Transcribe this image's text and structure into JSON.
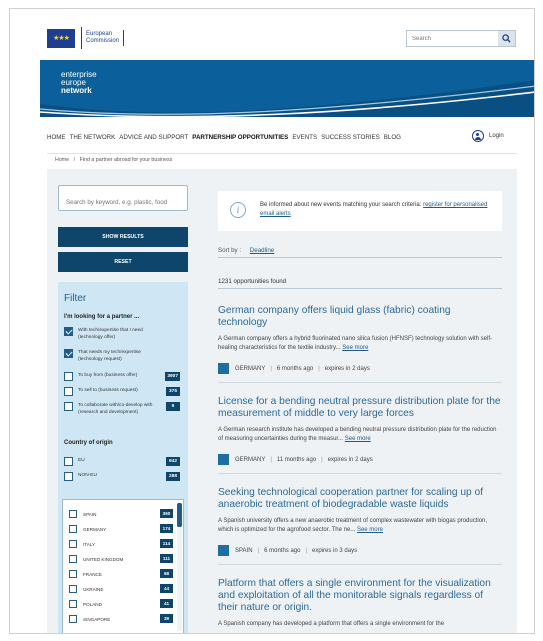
{
  "header": {
    "logo_line1": "European",
    "logo_line2": "Commission",
    "search_placeholder": "Search",
    "brand_line1": "enterprise",
    "brand_line2": "europe",
    "brand_line3": "network",
    "brand_color": "#0b5f9a"
  },
  "nav": {
    "items": [
      "HOME",
      "THE NETWORK",
      "ADVICE AND SUPPORT",
      "PARTNERSHIP OPPORTUNITIES",
      "EVENTS",
      "SUCCESS STORIES",
      "BLOG"
    ],
    "active": "PARTNERSHIP OPPORTUNITIES",
    "login": "Login"
  },
  "breadcrumb": {
    "home": "Home",
    "sep": "/",
    "current": "Find a partner abroad for your business"
  },
  "sidebar": {
    "keyword_placeholder": "Search by keyword, e.g. plastic, food",
    "show_results": "SHOW RESULTS",
    "reset": "RESET",
    "filter_title": "Filter",
    "looking_for_title": "I'm looking for a partner ...",
    "looking_for": [
      {
        "label": "With tech/expertise that I need (technology offer)",
        "checked": true,
        "count": ""
      },
      {
        "label": "That needs my tech/expertise (technology request)",
        "checked": true,
        "count": ""
      },
      {
        "label": "To buy from (business offer)",
        "checked": false,
        "count": "3907"
      },
      {
        "label": "To sell to (business request)",
        "checked": false,
        "count": "375"
      },
      {
        "label": "To collaborate with/co-develop with (research and development)",
        "checked": false,
        "count": "9"
      }
    ],
    "country_title": "Country of origin",
    "regions": [
      {
        "label": "EU",
        "count": "942"
      },
      {
        "label": "NON-EU",
        "count": "288"
      }
    ],
    "countries": [
      {
        "label": "SPAIN",
        "count": "360"
      },
      {
        "label": "GERMANY",
        "count": "174"
      },
      {
        "label": "ITALY",
        "count": "114"
      },
      {
        "label": "UNITED KINGDOM",
        "count": "111"
      },
      {
        "label": "FRANCE",
        "count": "68"
      },
      {
        "label": "UKRAINE",
        "count": "44"
      },
      {
        "label": "POLAND",
        "count": "41"
      },
      {
        "label": "SINGAPORE",
        "count": "39"
      }
    ]
  },
  "main": {
    "alert_text": "Be informed about new events matching your search criteria: ",
    "alert_link": "register for personalised email alerts",
    "sort_label": "Sort by :",
    "sort_value": "Deadline",
    "count_text": "1231 opportunities found",
    "see_more": "See more",
    "results": [
      {
        "title": "German company offers liquid glass (fabric) coating technology",
        "desc": "A German company offers a hybrid fluorinated nano silica fusion (HFNSF) technology solution with self-healing characteristics for the textile industry... ",
        "country": "GERMANY",
        "age": "6 months ago",
        "expires": "expires in 2 days"
      },
      {
        "title": "License for a bending neutral pressure distribution plate for the measurement of middle to very large forces",
        "desc": "A German research institute has developed a bending neutral pressure distribution plate for the reduction of measuring uncertainties during the measur... ",
        "country": "GERMANY",
        "age": "11 months ago",
        "expires": "expires in 2 days"
      },
      {
        "title": "Seeking technological cooperation partner for scaling up of anaerobic treatment of biodegradable waste liquids",
        "desc": "A Spanish university offers a new anaerobic treatment of complex wastewater with biogas production, which is optimized for the agrofood sector. The ne... ",
        "country": "SPAIN",
        "age": "6 months ago",
        "expires": "expires in 3 days"
      },
      {
        "title": "Platform that offers a single environment for the visualization and exploitation of all the monitorable signals regardless of their nature or origin.",
        "desc": "A Spanish company has developed a platform that offers a single environment for the",
        "country": "",
        "age": "",
        "expires": ""
      }
    ]
  }
}
